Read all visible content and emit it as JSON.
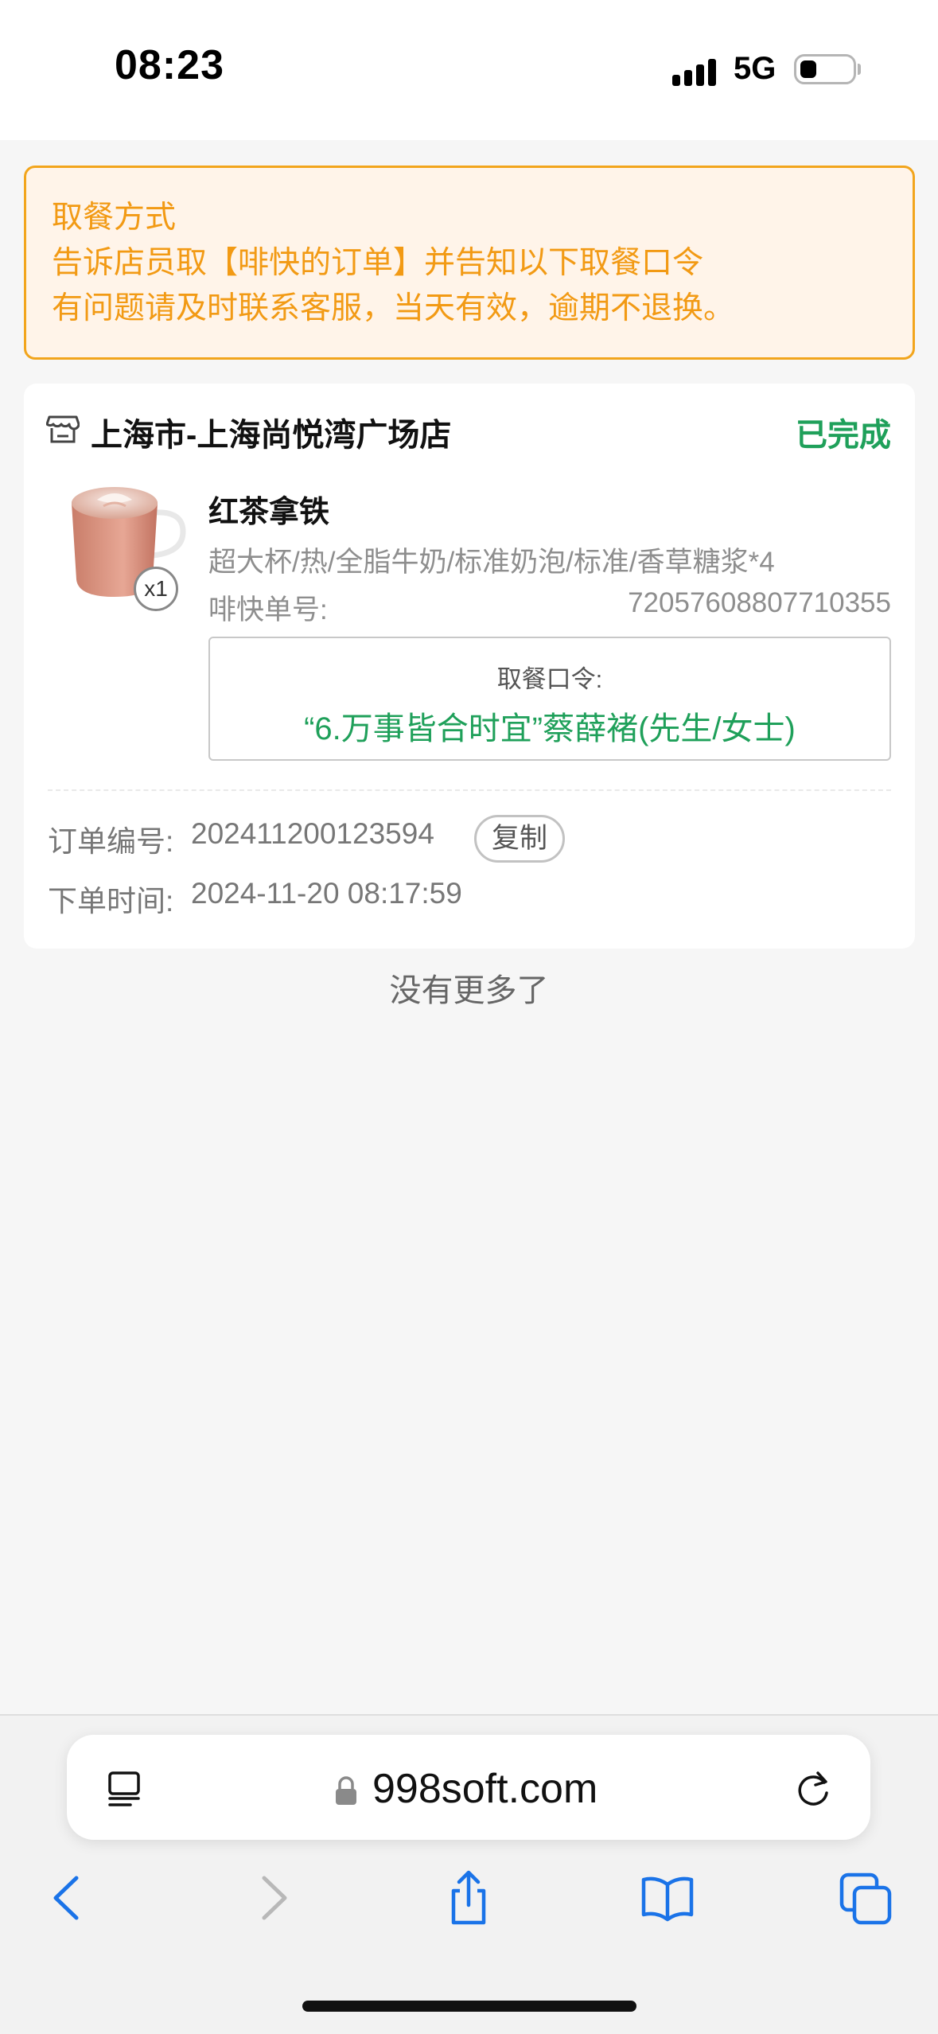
{
  "status_bar": {
    "time": "08:23",
    "network": "5G"
  },
  "notice": {
    "title": "取餐方式",
    "line1": "告诉店员取【啡快的订单】并告知以下取餐口令",
    "line2": "有问题请及时联系客服，当天有效，逾期不退换。"
  },
  "order": {
    "store_icon": "store-icon",
    "store_name": "上海市-上海尚悦湾广场店",
    "status": "已完成",
    "status_color": "#1fa05a",
    "product": {
      "name": "红茶拿铁",
      "spec": "超大杯/热/全脂牛奶/标准奶泡/标准/香草糖浆*4",
      "quantity": "x1",
      "order_no_label": "啡快单号:",
      "order_no": "72057608807710355"
    },
    "pickup": {
      "title": "取餐口令:",
      "code": "“6.万事皆合时宜”蔡薛褚(先生/女士)"
    },
    "order_number_label": "订单编号:",
    "order_number": "202411200123594",
    "copy_label": "复制",
    "order_time_label": "下单时间:",
    "order_time": "2024-11-20 08:17:59"
  },
  "list_end": "没有更多了",
  "browser": {
    "url": "998soft.com",
    "icons": [
      "reader-icon",
      "lock-icon",
      "reload-icon",
      "back-icon",
      "forward-icon",
      "share-icon",
      "bookmarks-icon",
      "tabs-icon"
    ]
  },
  "colors": {
    "accent_orange": "#f29a14",
    "accent_green": "#1fa05a",
    "ios_blue": "#1a73e8"
  }
}
